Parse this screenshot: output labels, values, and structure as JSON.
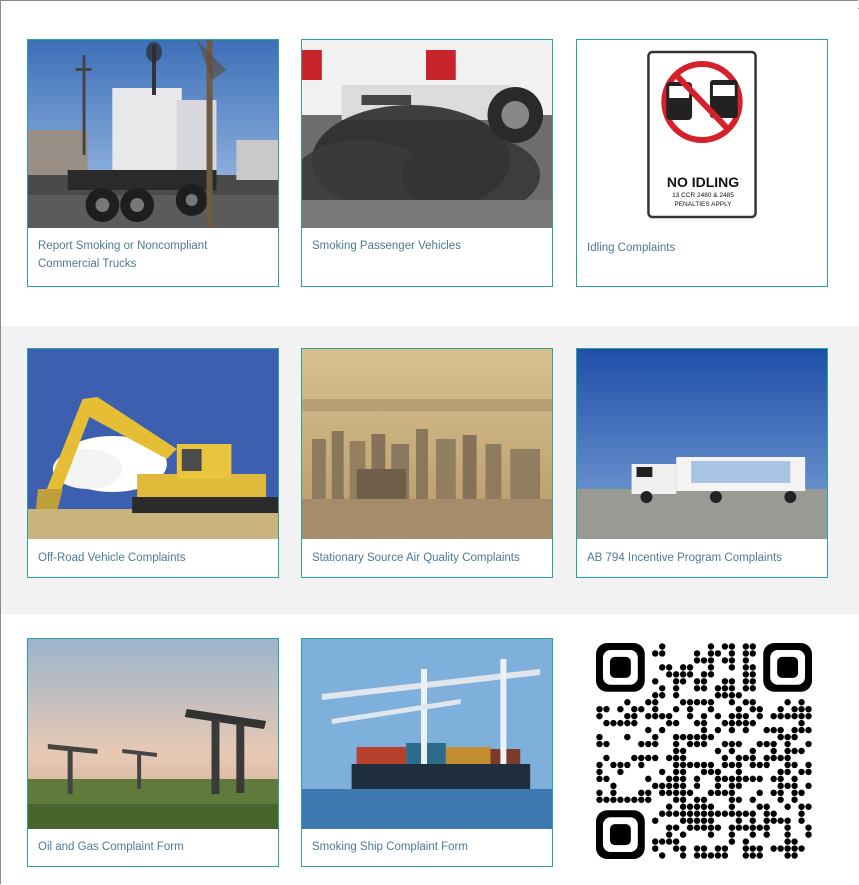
{
  "cards": [
    {
      "label": "Report Smoking or Noncompliant Commercial Trucks"
    },
    {
      "label": "Smoking Passenger Vehicles"
    },
    {
      "label": "Idling Complaints"
    },
    {
      "label": "Off-Road Vehicle Complaints"
    },
    {
      "label": "Stationary Source Air Quality Complaints"
    },
    {
      "label": "AB 794 Incentive Program Complaints"
    },
    {
      "label": "Oil and Gas Complaint Form"
    },
    {
      "label": "Smoking Ship Complaint Form"
    }
  ],
  "idling_sign": {
    "title": "NO IDLING",
    "line1": "13 CCR 2480 & 2485",
    "line2": "PENALTIES APPLY"
  },
  "colors": {
    "card_border": "#2ba59b",
    "label_text": "#4d7a95",
    "alt_band": "#f2f2f2"
  },
  "icons": {
    "qr_code": "qr-code-icon",
    "no_idling_sign": "no-idling-sign-icon"
  }
}
